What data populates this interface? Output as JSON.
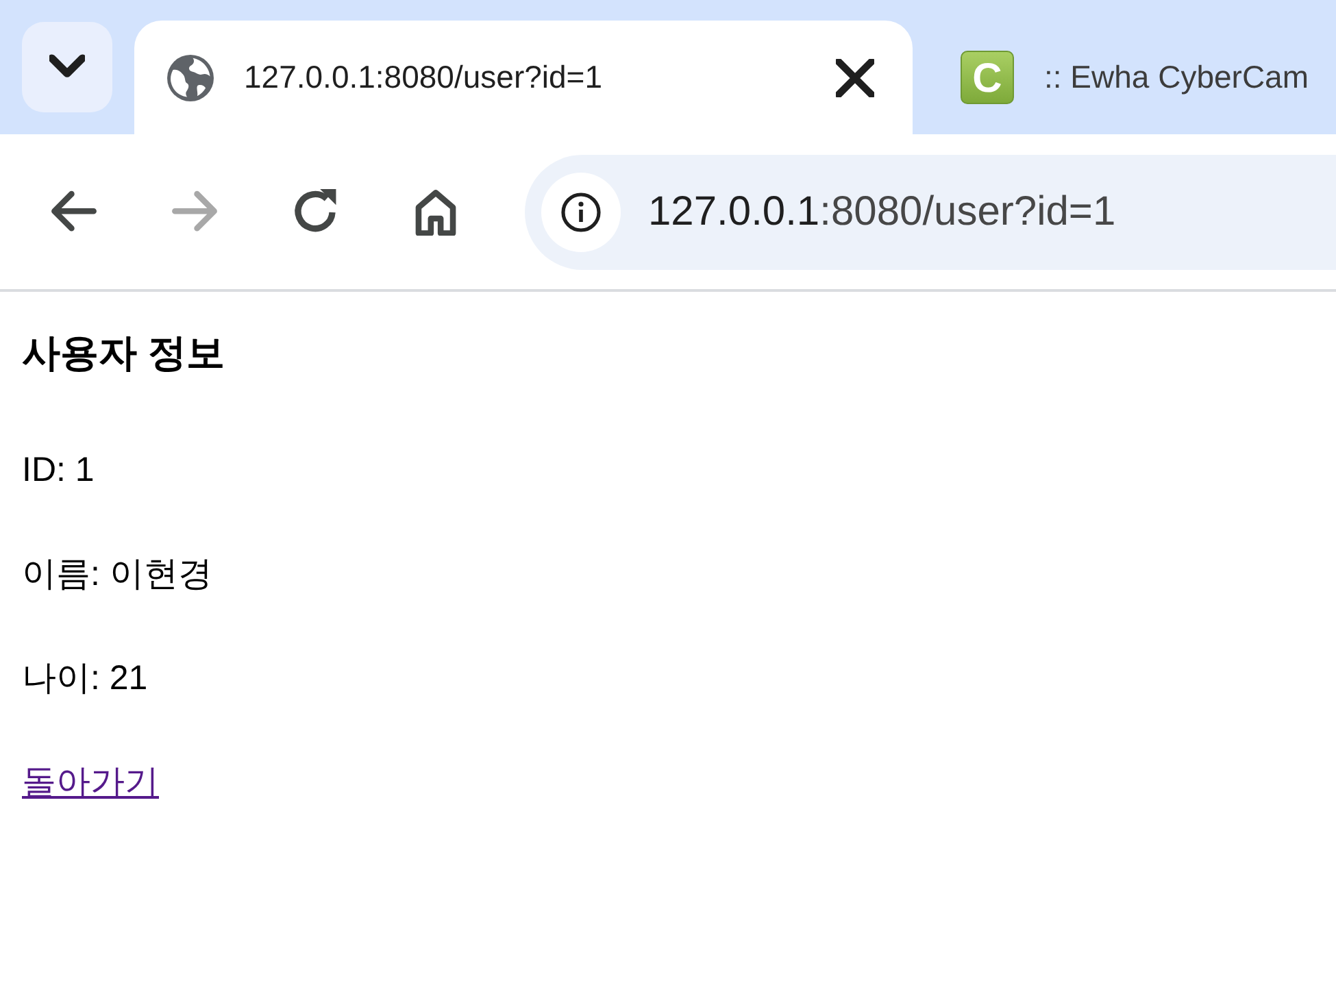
{
  "tabs": [
    {
      "title": "127.0.0.1:8080/user?id=1",
      "selected": true,
      "favicon": {
        "kind": "globe"
      }
    },
    {
      "title": ":: Ewha CyberCam",
      "selected": false,
      "favicon": {
        "kind": "letter",
        "letter": "C"
      }
    }
  ],
  "toolbar": {
    "buttons": [
      {
        "kind": "back",
        "disabled": false
      },
      {
        "kind": "forward",
        "disabled": true
      },
      {
        "kind": "reload",
        "disabled": false
      },
      {
        "kind": "home",
        "disabled": false
      }
    ]
  },
  "address_bar": {
    "host": "127.0.0.1",
    "path": ":8080/user?id=1"
  },
  "page": {
    "heading": "사용자 정보",
    "lines": [
      "ID: 1",
      "이름: 이현경",
      "나이: 21"
    ],
    "link": {
      "label": "돌아가기",
      "visited": true
    }
  }
}
